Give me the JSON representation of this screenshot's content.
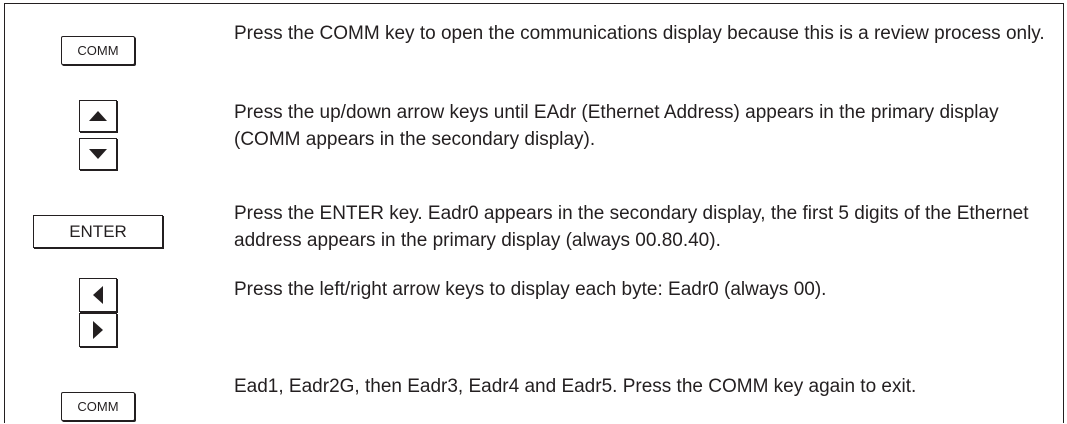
{
  "steps": [
    {
      "keys": [
        "COMM"
      ],
      "text": "Press the COMM key to open the communications display because this is a review process only."
    },
    {
      "keys": [
        "up-arrow",
        "down-arrow"
      ],
      "text": "Press the up/down arrow keys until EAdr (Ethernet Address) appears in the primary display (COMM appears in the secondary display)."
    },
    {
      "keys": [
        "ENTER"
      ],
      "text": "Press the ENTER key. Eadr0 appears in the secondary display, the first 5 digits of the Ethernet address appears in the primary display (always 00.80.40)."
    },
    {
      "keys": [
        "left-arrow",
        "right-arrow"
      ],
      "text": "Press the left/right arrow keys to display each byte: Eadr0 (always 00)."
    },
    {
      "keys": [
        "COMM"
      ],
      "text": "Ead1, Eadr2G, then Eadr3, Eadr4 and Eadr5. Press the COMM key again to exit."
    }
  ],
  "labels": {
    "comm_key": "COMM",
    "enter_key": "ENTER"
  }
}
